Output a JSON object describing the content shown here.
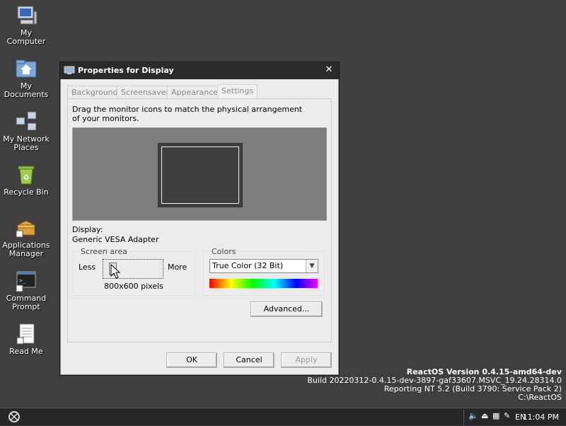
{
  "desktop": {
    "icons": [
      {
        "label": "My Computer",
        "icon": "computer-icon"
      },
      {
        "label": "My Documents",
        "icon": "documents-folder-icon"
      },
      {
        "label": "My Network Places",
        "icon": "network-icon"
      },
      {
        "label": "Recycle Bin",
        "icon": "recycle-bin-icon"
      },
      {
        "label": "Applications Manager",
        "icon": "applications-manager-icon"
      },
      {
        "label": "Command Prompt",
        "icon": "command-prompt-icon"
      },
      {
        "label": "Read Me",
        "icon": "text-document-icon"
      }
    ]
  },
  "version_info": {
    "line1": "ReactOS Version 0.4.15-amd64-dev",
    "line2": "Build 20220312-0.4.15-dev-3897-gaf33607.MSVC_19.24.28314.0",
    "line3": "Reporting NT 5.2 (Build 3790: Service Pack 2)",
    "line4": "C:\\ReactOS"
  },
  "dialog": {
    "title": "Properties for Display",
    "tabs": [
      "Background",
      "Screensaver",
      "Appearance",
      "Settings"
    ],
    "active_tab": "Settings",
    "instruction": "Drag the monitor icons to match the physical arrangement of your monitors.",
    "display_label": "Display:",
    "display_value": "Generic VESA Adapter",
    "screen_area": {
      "title": "Screen area",
      "less": "Less",
      "more": "More",
      "resolution": "800x600 pixels"
    },
    "colors": {
      "title": "Colors",
      "selected": "True Color (32 Bit)"
    },
    "buttons": {
      "advanced": "Advanced...",
      "ok": "OK",
      "cancel": "Cancel",
      "apply": "Apply"
    }
  },
  "taskbar": {
    "language": "EN",
    "clock": "11:04 PM"
  }
}
